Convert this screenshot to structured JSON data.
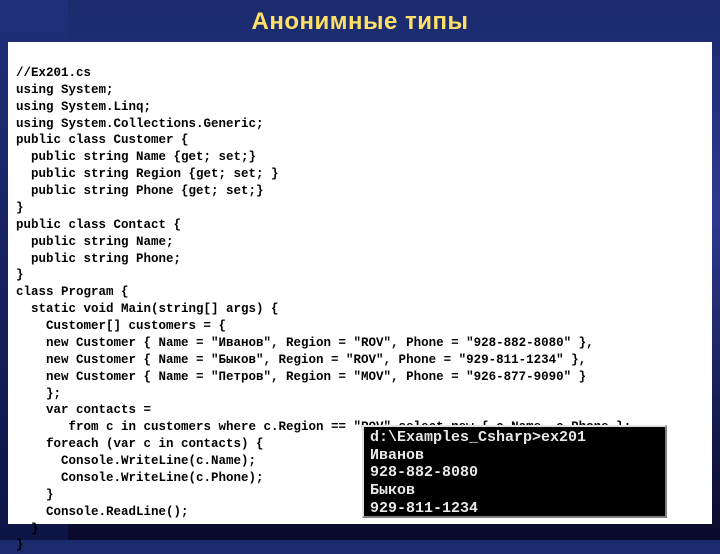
{
  "slide": {
    "title": "Анонимные типы"
  },
  "code": {
    "lines": [
      "//Ex201.cs",
      "using System;",
      "using System.Linq;",
      "using System.Collections.Generic;",
      "public class Customer {",
      "  public string Name {get; set;}",
      "  public string Region {get; set; }",
      "  public string Phone {get; set;}",
      "}",
      "public class Contact {",
      "  public string Name;",
      "  public string Phone;",
      "}",
      "class Program {",
      "  static void Main(string[] args) {",
      "    Customer[] customers = {",
      "    new Customer { Name = \"Иванов\", Region = \"ROV\", Phone = \"928-882-8080\" },",
      "    new Customer { Name = \"Быков\", Region = \"ROV\", Phone = \"929-811-1234\" },",
      "    new Customer { Name = \"Петров\", Region = \"MOV\", Phone = \"926-877-9090\" }",
      "    };",
      "    var contacts =",
      "       from c in customers where c.Region == \"ROV\" select new { c.Name, c.Phone };",
      "    foreach (var c in contacts) {",
      "      Console.WriteLine(c.Name);",
      "      Console.WriteLine(c.Phone);",
      "    }",
      "    Console.ReadLine();",
      "  }",
      "}"
    ]
  },
  "console": {
    "lines": [
      "d:\\Examples_Csharp>ex201",
      "Иванов",
      "928-882-8080",
      "Быков",
      "929-811-1234"
    ]
  }
}
